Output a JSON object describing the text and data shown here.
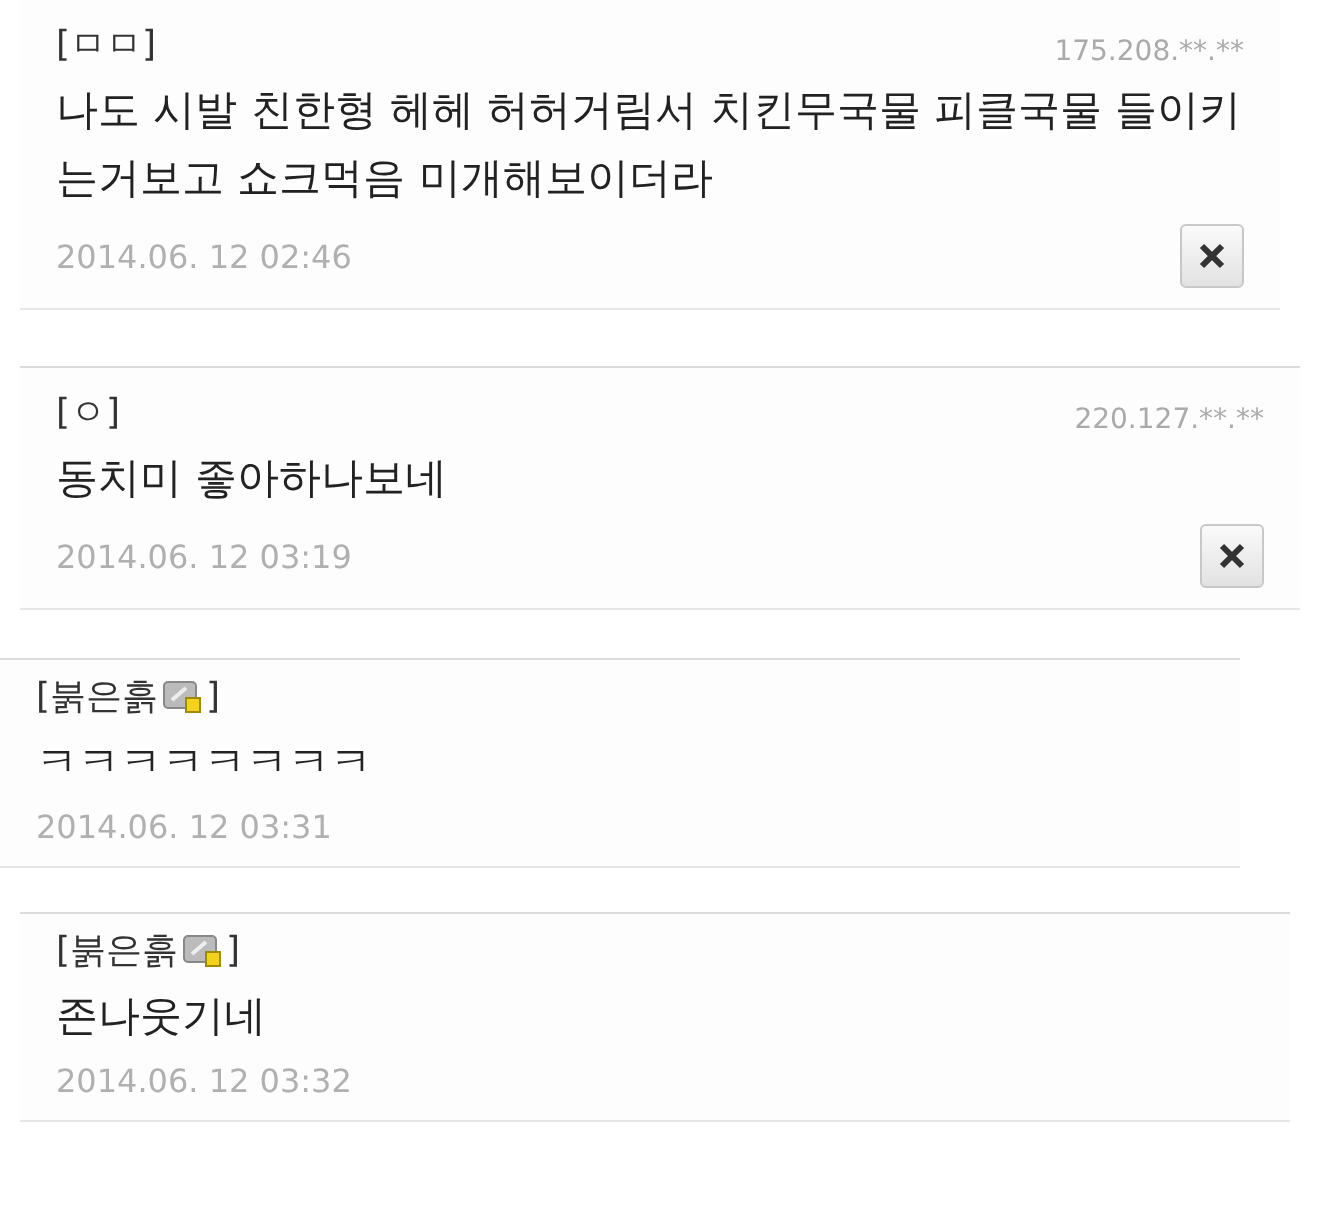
{
  "comments": [
    {
      "author": "[ㅁㅁ]",
      "badge": false,
      "ip": "175.208.**.**",
      "text": "나도 시발 친한형 헤헤 허허거림서 치킨무국물 피클국물 들이키는거보고 쇼크먹음 미개해보이더라",
      "date": "2014.06. 12 02:46",
      "deletable": true
    },
    {
      "author": "[ㅇ]",
      "badge": false,
      "ip": "220.127.**.**",
      "text": "동치미 좋아하나보네",
      "date": "2014.06. 12 03:19",
      "deletable": true
    },
    {
      "author": "[붉은흙",
      "author_end": "]",
      "badge": true,
      "text": "ㅋㅋㅋㅋㅋㅋㅋㅋ",
      "date": "2014.06. 12 03:31",
      "deletable": false
    },
    {
      "author": "[붉은흙",
      "author_end": "]",
      "badge": true,
      "text": "존나웃기네",
      "date": "2014.06. 12 03:32",
      "deletable": false
    }
  ]
}
